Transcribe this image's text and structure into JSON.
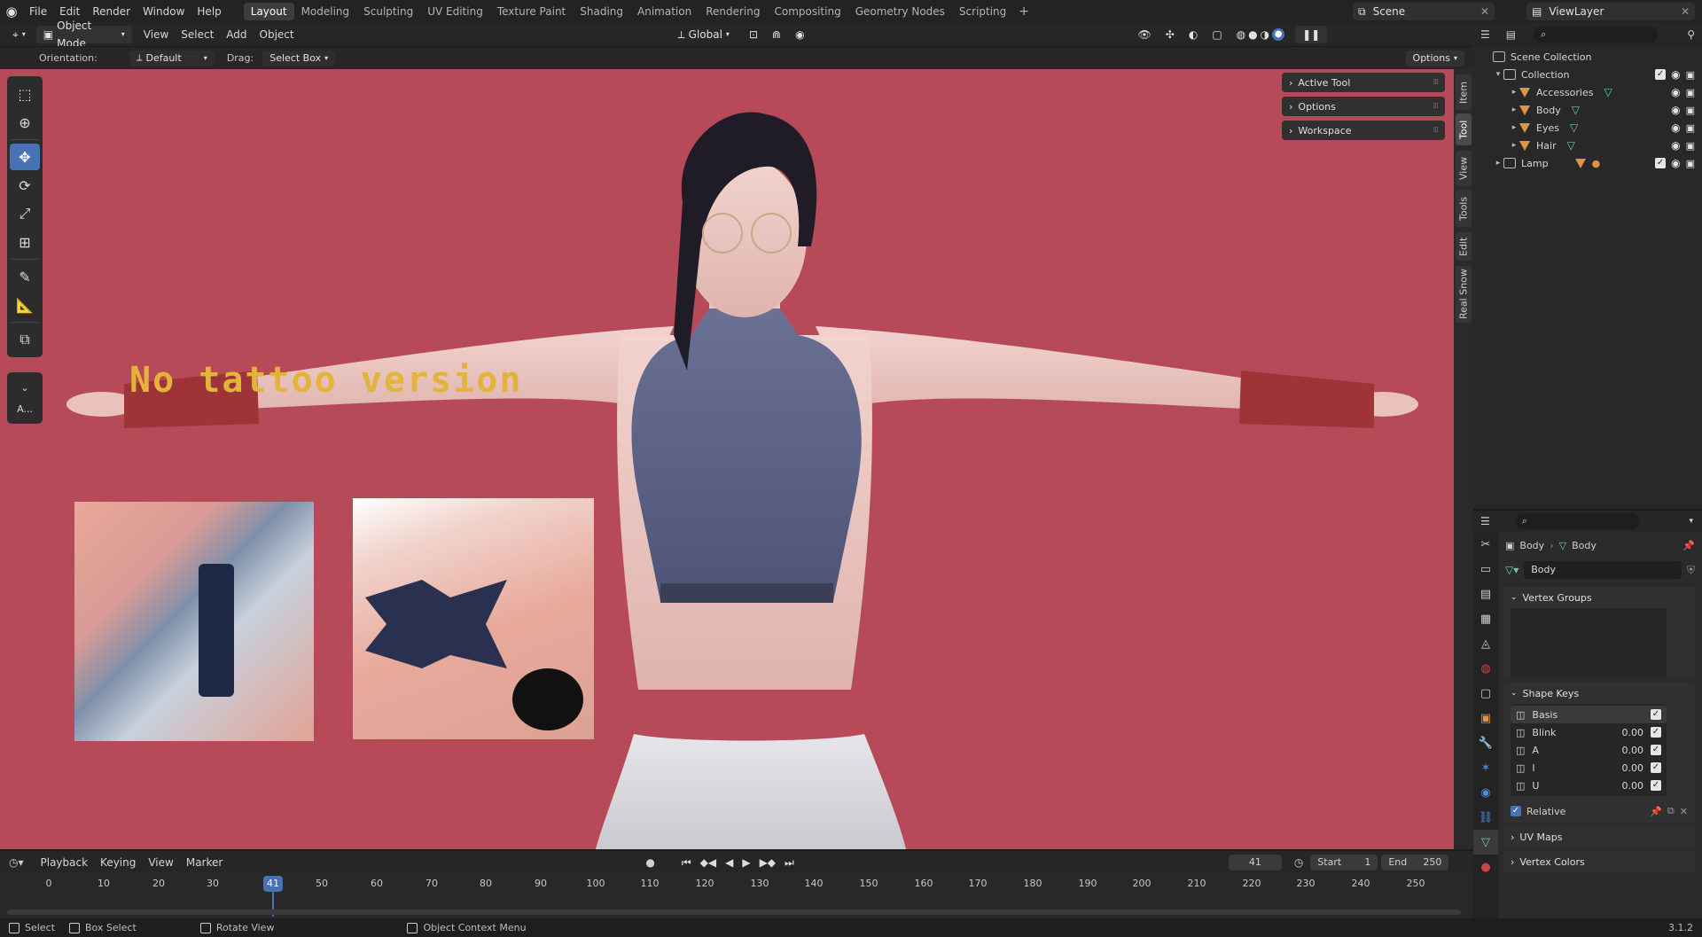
{
  "topbar": {
    "menus": [
      "File",
      "Edit",
      "Render",
      "Window",
      "Help"
    ],
    "workspaces": [
      "Layout",
      "Modeling",
      "Sculpting",
      "UV Editing",
      "Texture Paint",
      "Shading",
      "Animation",
      "Rendering",
      "Compositing",
      "Geometry Nodes",
      "Scripting"
    ],
    "active_workspace": "Layout",
    "add_icon": "+",
    "scene": "Scene",
    "view_layer": "ViewLayer"
  },
  "viewport_header": {
    "mode": "Object Mode",
    "menus": [
      "View",
      "Select",
      "Add",
      "Object"
    ],
    "transform_orientation": "Global"
  },
  "tool_settings": {
    "orientation_label": "Orientation:",
    "orientation_value": "Default",
    "drag_label": "Drag:",
    "drag_value": "Select Box",
    "options_label": "Options"
  },
  "viewport": {
    "overlay_text": "No tattoo version",
    "npanel": [
      "Active Tool",
      "Options",
      "Workspace"
    ],
    "side_tabs": [
      "Item",
      "Tool",
      "View",
      "Tools",
      "Edit",
      "Real Snow"
    ],
    "active_side_tab": "Tool",
    "toolbar_extra": "A..."
  },
  "outliner": {
    "scene_collection": "Scene Collection",
    "collection": "Collection",
    "items": [
      "Accessories",
      "Body",
      "Eyes",
      "Hair"
    ],
    "lamp": "Lamp"
  },
  "properties": {
    "breadcrumb_object": "Body",
    "breadcrumb_mesh": "Body",
    "mesh_name": "Body",
    "vertex_groups": "Vertex Groups",
    "shape_keys": "Shape Keys",
    "shape_key_rows": [
      {
        "name": "Basis",
        "value": ""
      },
      {
        "name": "Blink",
        "value": "0.00"
      },
      {
        "name": "A",
        "value": "0.00"
      },
      {
        "name": "I",
        "value": "0.00"
      },
      {
        "name": "U",
        "value": "0.00"
      }
    ],
    "relative": "Relative",
    "uv_maps": "UV Maps",
    "vertex_colors": "Vertex Colors"
  },
  "timeline": {
    "menus": [
      "Playback",
      "Keying",
      "View",
      "Marker"
    ],
    "current_frame": "41",
    "start_label": "Start",
    "start_value": "1",
    "end_label": "End",
    "end_value": "250",
    "ticks": [
      "0",
      "10",
      "20",
      "30",
      "50",
      "60",
      "70",
      "80",
      "90",
      "100",
      "110",
      "120",
      "130",
      "140",
      "150",
      "160",
      "170",
      "180",
      "190",
      "200",
      "210",
      "220",
      "230",
      "240",
      "250"
    ]
  },
  "status": {
    "select": "Select",
    "box_select": "Box Select",
    "rotate_view": "Rotate View",
    "context_menu": "Object Context Menu",
    "version": "3.1.2"
  },
  "colors": {
    "viewport_bg": "#b64a59",
    "accent": "#4772b3",
    "overlay_text": "#e2b43a"
  }
}
